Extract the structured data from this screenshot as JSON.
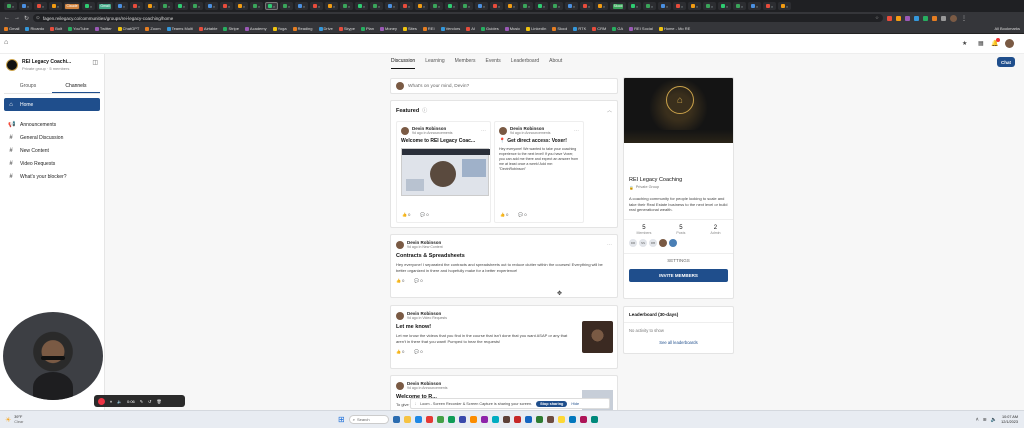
{
  "browser": {
    "url": "fagen.reilegacy.co/communities/groups/rei-legacy-coaching/home",
    "tab_chips": [
      {
        "label": "Claude",
        "color": "#d1843f"
      },
      {
        "label": "Gmail",
        "color": "#4a8"
      },
      {
        "label": "Skool",
        "color": "#3aa55a"
      }
    ],
    "bookmarks": [
      "Gmail",
      "Ricardo",
      "Bolt",
      "YouTube",
      "Twitter",
      "ChatGPT",
      "Zoom",
      "Teams Multi",
      "Airtable",
      "Stripe",
      "Academy",
      "Yoga",
      "Reading",
      "Drive",
      "Skype",
      "Plan",
      "Money",
      "Sites",
      "REI",
      "Vendors",
      "AI",
      "Guides",
      "Music",
      "LinkedIn",
      "Skool",
      "RTK",
      "CRM",
      "GA",
      "REI Social",
      "Home - Mo RE"
    ],
    "all_bookmarks": "All Bookmarks"
  },
  "group": {
    "name": "REI Legacy Coachi...",
    "privacy": "Private group",
    "members_short": "5 members"
  },
  "sidebar": {
    "tabs": [
      "Groups",
      "Channels"
    ],
    "active_tab": 1,
    "items": [
      {
        "label": "Home",
        "icon": "home-icon",
        "glyph": "⌂",
        "active": true
      },
      {
        "label": "Announcements",
        "icon": "megaphone-icon",
        "glyph": "📢",
        "active": false
      },
      {
        "label": "General Discussion",
        "icon": "hash-icon",
        "glyph": "#",
        "active": false
      },
      {
        "label": "New Content",
        "icon": "hash-icon",
        "glyph": "#",
        "active": false
      },
      {
        "label": "Video Requests",
        "icon": "hash-icon",
        "glyph": "#",
        "active": false
      },
      {
        "label": "What's your blocker?",
        "icon": "hash-icon",
        "glyph": "#",
        "active": false
      }
    ]
  },
  "nav_tabs": [
    "Discussion",
    "Learning",
    "Members",
    "Events",
    "Leaderboard",
    "About"
  ],
  "active_nav": 0,
  "chat_button": "Chat",
  "composer": {
    "placeholder": "What's on your mind, Devin?"
  },
  "featured": {
    "heading": "Featured",
    "posts": [
      {
        "author": "Devin Robinson",
        "meta": "9d ago in Announcements",
        "title": "Welcome to REI Legacy Coac...",
        "likes": "0",
        "comments": "0"
      },
      {
        "author": "Devin Robinson",
        "meta": "9d ago in Announcements",
        "title": "Get direct access: Voxer!",
        "body": "Hey everyone! We wanted to take your coaching experience to the next level! If you have Voxer, you can add me there and expect an answer from me at least once a week! Add me: \"DevinRobinson\"",
        "likes": "0",
        "comments": "0"
      }
    ]
  },
  "posts": [
    {
      "author": "Devin Robinson",
      "meta": "9d ago in New Content",
      "title": "Contracts & Spreadsheets",
      "body": "Hey everyone! I separated the contracts and spreadsheets out to reduce clutter within the courses! Everything will be better organized in there and hopefully make for a better experience!",
      "likes": "0",
      "comments": "0"
    },
    {
      "author": "Devin Robinson",
      "meta": "9d ago in Video Requests",
      "title": "Let me know!",
      "body": "Let me know the videos that you find in the course that isn't done that you want ASAP or any that aren't in there that you want! Pumped to hear the requests!",
      "likes": "0",
      "comments": "0"
    },
    {
      "author": "Devin Robinson",
      "meta": "9d ago in Announcements",
      "title": "Welcome to R...",
      "body": "To give you a run..."
    }
  ],
  "about_card": {
    "name": "REI Legacy Coaching",
    "privacy": "Private Group",
    "description": "A coaching community for people looking to scale and take their Real Estate business to the next level or build real generational wealth.",
    "stats": [
      {
        "value": "5",
        "label": "Members"
      },
      {
        "value": "5",
        "label": "Posts"
      },
      {
        "value": "2",
        "label": "Admin"
      }
    ],
    "member_initials": [
      "DR",
      "SS",
      "RB"
    ],
    "settings_label": "SETTINGS",
    "invite_label": "INVITE MEMBERS"
  },
  "leaderboard": {
    "title": "Leaderboard (30-days)",
    "empty": "No activity to show",
    "link": "See all leaderboards"
  },
  "recorder": {
    "time": "0:06"
  },
  "share_notice": {
    "text": "Loom - Screen Recorder & Screen Capture is sharing your screen.",
    "stop_label": "Stop sharing",
    "hide_label": "Hide"
  },
  "taskbar": {
    "weather_temp": "39°F",
    "weather_desc": "Clear",
    "search_placeholder": "Search",
    "time": "10:07 AM",
    "date": "12/1/2023"
  },
  "colors": {
    "brand": "#1f4e8c",
    "accent_gold": "#c9a14a",
    "dark_banner": "#141414"
  }
}
